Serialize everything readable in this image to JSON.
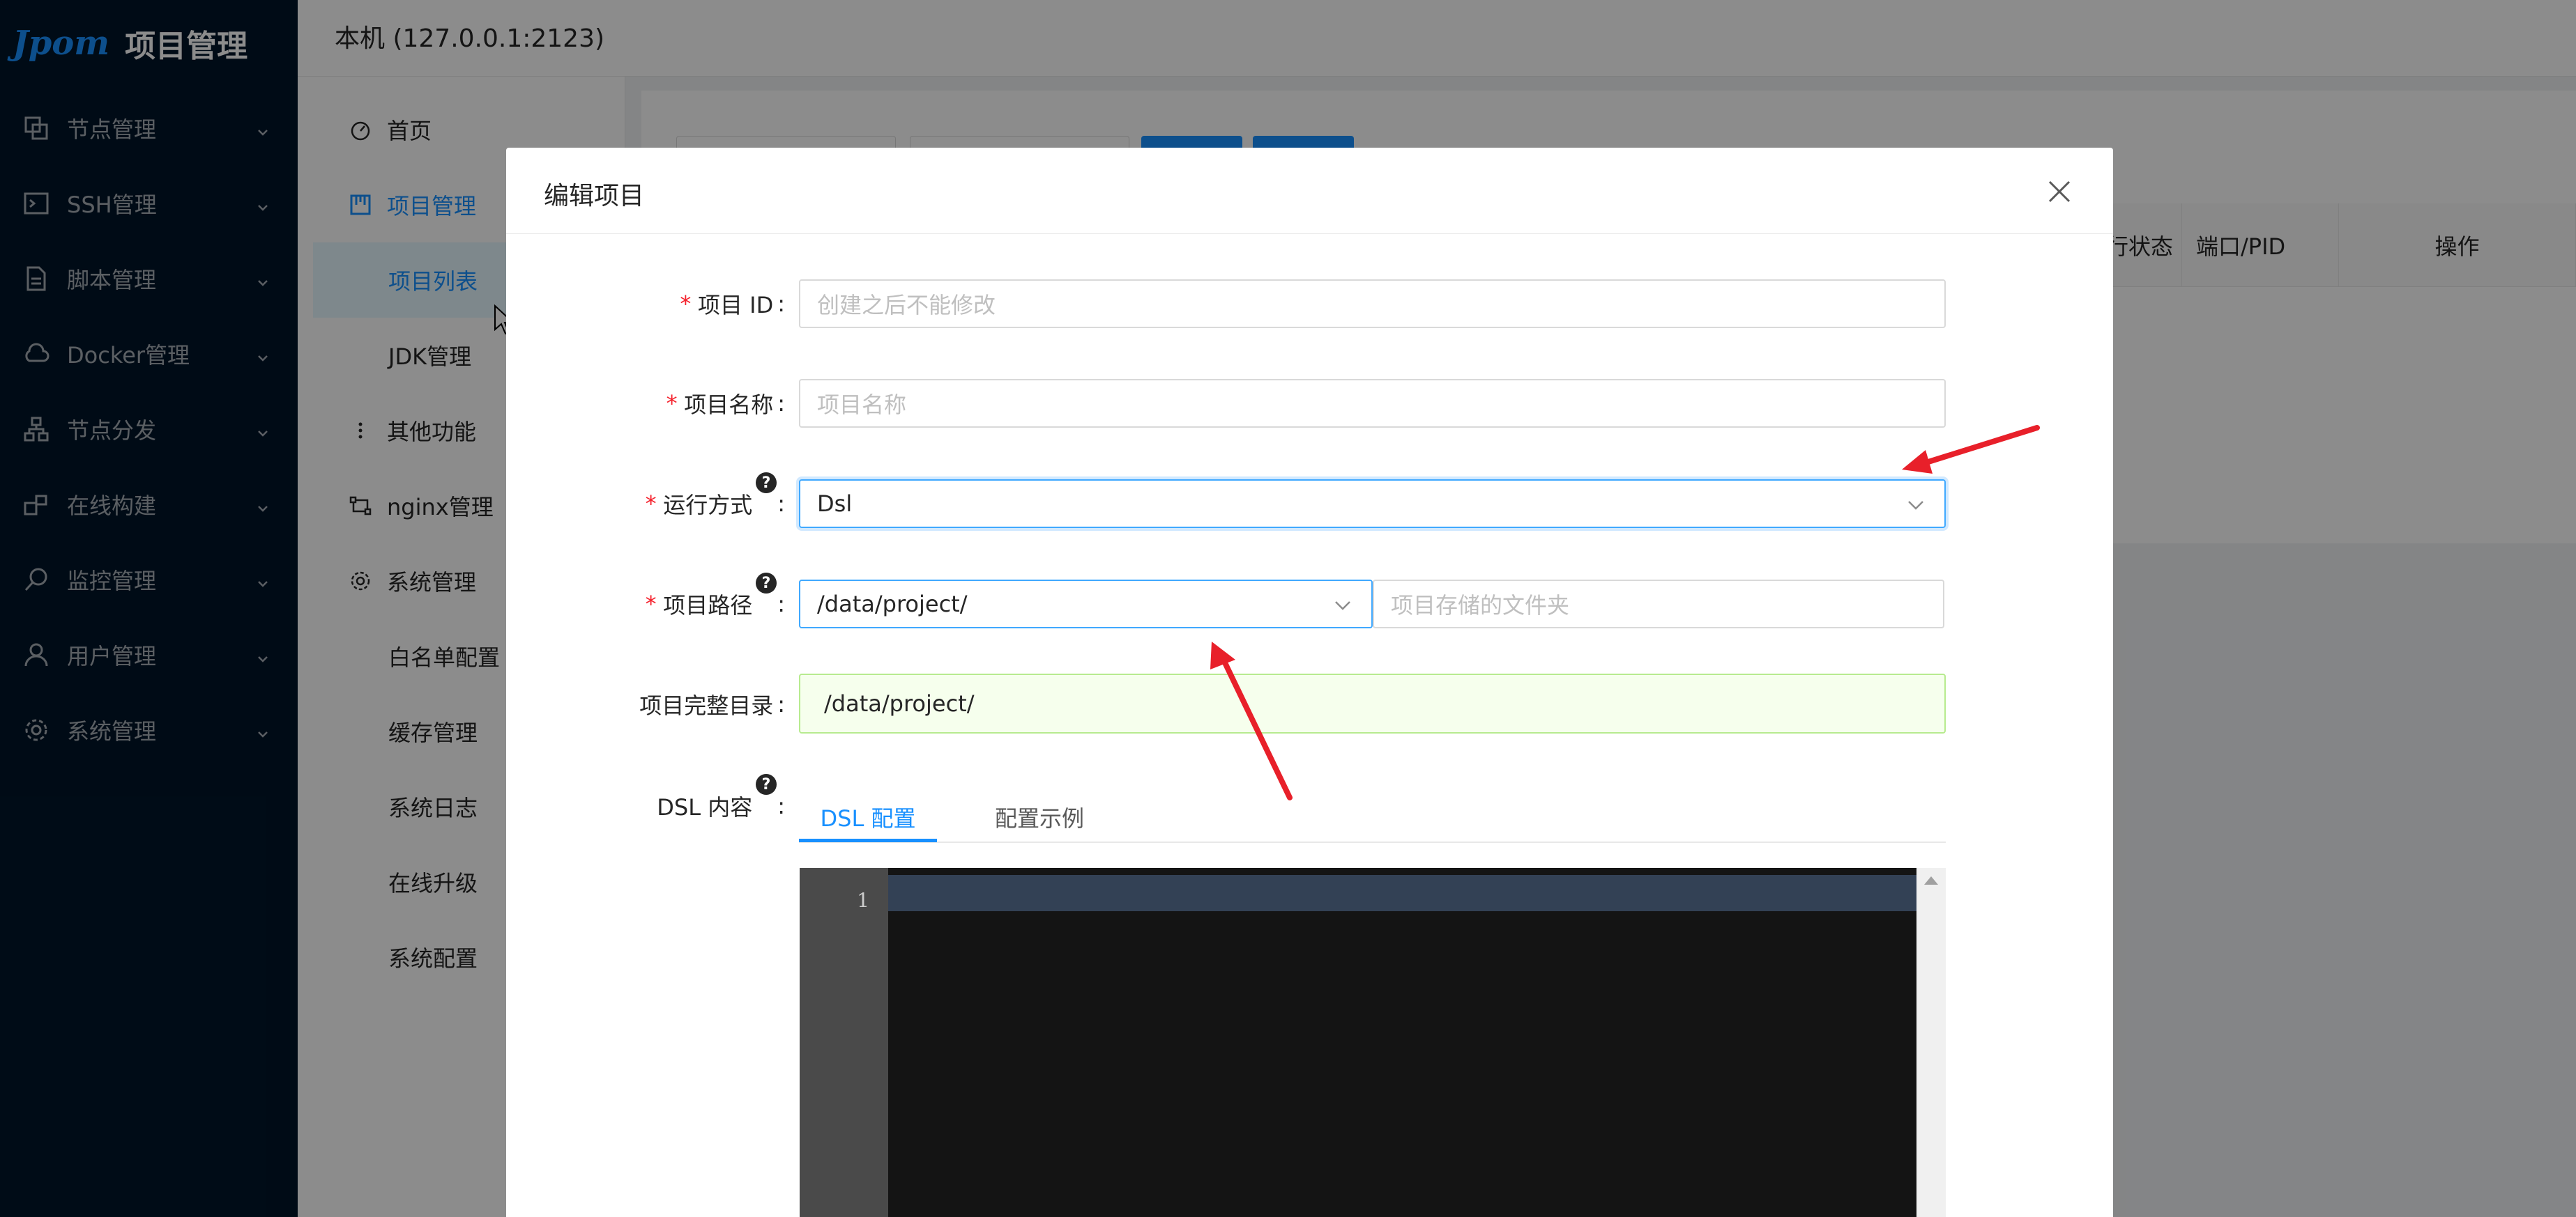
{
  "app": {
    "logo_text": "Jpom",
    "title": "项目管理"
  },
  "sider": {
    "items": [
      {
        "label": "节点管理",
        "icon": "node-icon"
      },
      {
        "label": "SSH管理",
        "icon": "terminal-icon"
      },
      {
        "label": "脚本管理",
        "icon": "file-icon"
      },
      {
        "label": "Docker管理",
        "icon": "cloud-icon"
      },
      {
        "label": "节点分发",
        "icon": "cluster-icon"
      },
      {
        "label": "在线构建",
        "icon": "build-icon"
      },
      {
        "label": "监控管理",
        "icon": "monitor-icon"
      },
      {
        "label": "用户管理",
        "icon": "user-icon"
      },
      {
        "label": "系统管理",
        "icon": "gear-icon"
      }
    ]
  },
  "header": {
    "node_title": "本机 (127.0.0.1:2123)"
  },
  "submenu": {
    "home": "首页",
    "project_mgmt": "项目管理",
    "project_list": "项目列表",
    "jdk_mgmt": "JDK管理",
    "other_features": "其他功能",
    "nginx_mgmt": "nginx管理",
    "system_mgmt": "系统管理",
    "whitelist": "白名单配置",
    "cache_mgmt": "缓存管理",
    "system_log": "系统日志",
    "online_upgrade": "在线升级",
    "system_config": "系统配置"
  },
  "table": {
    "col_status": "运行状态",
    "col_port": "端口/PID",
    "col_action": "操作"
  },
  "modal": {
    "title": "编辑项目",
    "fields": {
      "project_id": {
        "label": "项目 ID",
        "placeholder": "创建之后不能修改",
        "value": ""
      },
      "project_name": {
        "label": "项目名称",
        "placeholder": "项目名称",
        "value": ""
      },
      "run_mode": {
        "label": "运行方式",
        "value": "Dsl"
      },
      "project_path": {
        "label": "项目路径",
        "value": "/data/project/",
        "folder_placeholder": "项目存储的文件夹"
      },
      "full_dir": {
        "label": "项目完整目录",
        "value": "/data/project/"
      },
      "dsl_content": {
        "label": "DSL 内容"
      }
    },
    "tabs": [
      "DSL 配置",
      "配置示例"
    ],
    "editor": {
      "line_numbers": [
        "1"
      ]
    }
  },
  "colors": {
    "sider_bg": "#001529",
    "primary": "#1890ff",
    "required": "#f5222d",
    "annotation_arrow": "#e8202a"
  }
}
